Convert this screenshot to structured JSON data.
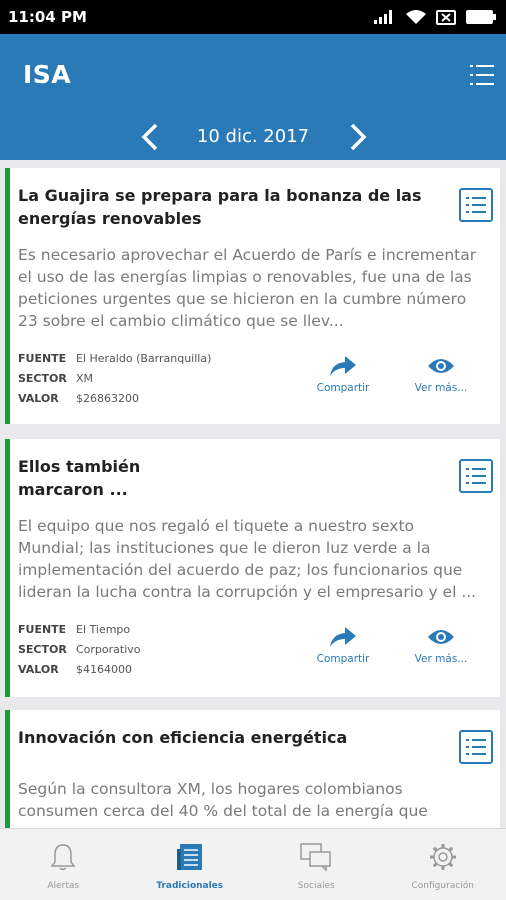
{
  "status_bar": {
    "time": "11:04 PM",
    "icons": [
      "signal-icon",
      "wifi-icon",
      "data-off-icon",
      "battery-icon"
    ]
  },
  "app_bar": {
    "title": "ISA",
    "menu_icon": "list-icon",
    "date": "10 dic. 2017",
    "prev_icon": "chevron-left-icon",
    "next_icon": "chevron-right-icon"
  },
  "labels": {
    "fuente": "FUENTE",
    "sector": "SECTOR",
    "valor": "VALOR",
    "share": "Compartir",
    "more": "Ver más..."
  },
  "cards": [
    {
      "title": "La Guajira se prepara para la bonanza de las energías renovables",
      "summary": "Es necesario aprovechar el Acuerdo de París e incrementar el uso de las energías limpias o renovables, fue una de las peticiones urgentes que se hicieron en la cumbre número 23 sobre el cambio climático que se llev...",
      "fuente": "El Heraldo (Barranquilla)",
      "sector": "XM",
      "valor": "$26863200"
    },
    {
      "title": "Ellos también marcaron ...",
      "summary": "El equipo que nos regaló el tiquete a nuestro sexto Mundial; las instituciones que le dieron luz verde a la implementación del acuerdo de paz; los funcionarios que lideran la lucha contra la corrupción y el empresario y el ...",
      "fuente": "El Tiempo",
      "sector": "Corporativo",
      "valor": "$4164000"
    },
    {
      "title": "Innovación con eficiencia energética",
      "summary": "Según la consultora XM, los hogares colombianos consumen cerca del 40 % del total de la energía que"
    }
  ],
  "bottom_nav": [
    {
      "label": "Alertas",
      "icon": "bell-icon",
      "active": false
    },
    {
      "label": "Tradicionales",
      "icon": "newspaper-icon",
      "active": true
    },
    {
      "label": "Sociales",
      "icon": "chat-icon",
      "active": false
    },
    {
      "label": "Configuración",
      "icon": "gear-icon",
      "active": false
    }
  ],
  "colors": {
    "primary": "#2a7ab8",
    "accent_green": "#1e9a3e",
    "background": "#e9e9ec"
  }
}
